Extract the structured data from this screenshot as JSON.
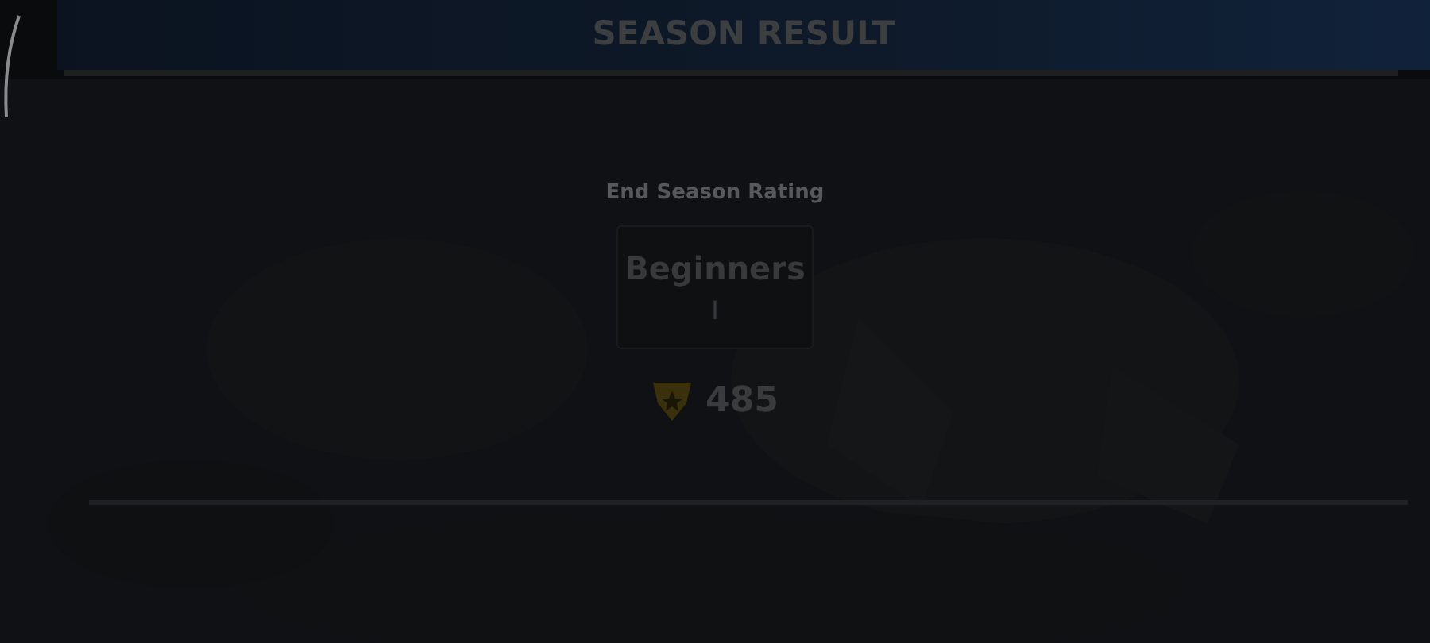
{
  "header": {
    "title": "SEASON RESULT"
  },
  "result": {
    "label": "End Season Rating",
    "rank": "Beginners",
    "tier": "I",
    "points": "485"
  }
}
